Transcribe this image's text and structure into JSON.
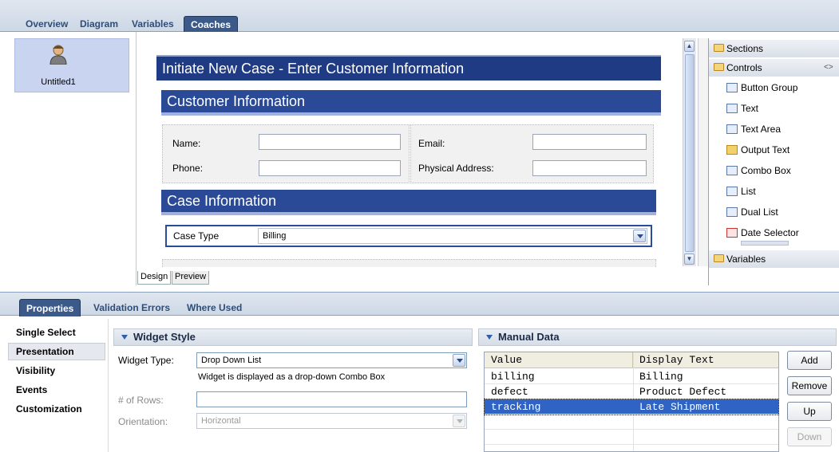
{
  "top_tabs": [
    "Overview",
    "Diagram",
    "Variables",
    "Coaches"
  ],
  "coach_list": {
    "items": [
      {
        "label": "Untitled1"
      }
    ]
  },
  "form": {
    "title": "Initiate New Case -  Enter Customer Information",
    "customer_section": {
      "heading": "Customer Information",
      "fields": {
        "name": "Name:",
        "email": "Email:",
        "phone": "Phone:",
        "address": "Physical Address:"
      }
    },
    "case_section": {
      "heading": "Case Information",
      "case_type_label": "Case Type",
      "case_type_value": "Billing"
    }
  },
  "palette": {
    "sections_label": "Sections",
    "controls_label": "Controls",
    "controls_collapse_glyph": "<>",
    "controls": [
      "Button Group",
      "Text",
      "Text Area",
      "Output Text",
      "Combo Box",
      "List",
      "Dual List",
      "Date Selector"
    ],
    "variables_label": "Variables"
  },
  "editor_tabs": [
    "Design",
    "Preview"
  ],
  "bottom_tabs": [
    "Properties",
    "Validation Errors",
    "Where Used"
  ],
  "property_categories": [
    "Single Select",
    "Presentation",
    "Visibility",
    "Events",
    "Customization"
  ],
  "widget_style": {
    "title": "Widget Style",
    "widget_type_label": "Widget Type:",
    "widget_type_value": "Drop Down List",
    "widget_type_desc": "Widget is displayed as a drop-down Combo Box",
    "rows_label": "# of Rows:",
    "rows_value": "",
    "orientation_label": "Orientation:",
    "orientation_value": "Horizontal"
  },
  "manual_data": {
    "title": "Manual Data",
    "columns": [
      "Value",
      "Display Text"
    ],
    "rows": [
      {
        "value": "billing",
        "display": "Billing"
      },
      {
        "value": "defect",
        "display": "Product Defect"
      },
      {
        "value": "tracking",
        "display": "Late Shipment"
      }
    ],
    "selected_row": 2,
    "buttons": {
      "add": "Add",
      "remove": "Remove",
      "up": "Up",
      "down": "Down"
    }
  },
  "colors": {
    "header_blue": "#1f3b84",
    "selection_blue": "#2f63c4",
    "tab_active": "#3b5a8a"
  }
}
